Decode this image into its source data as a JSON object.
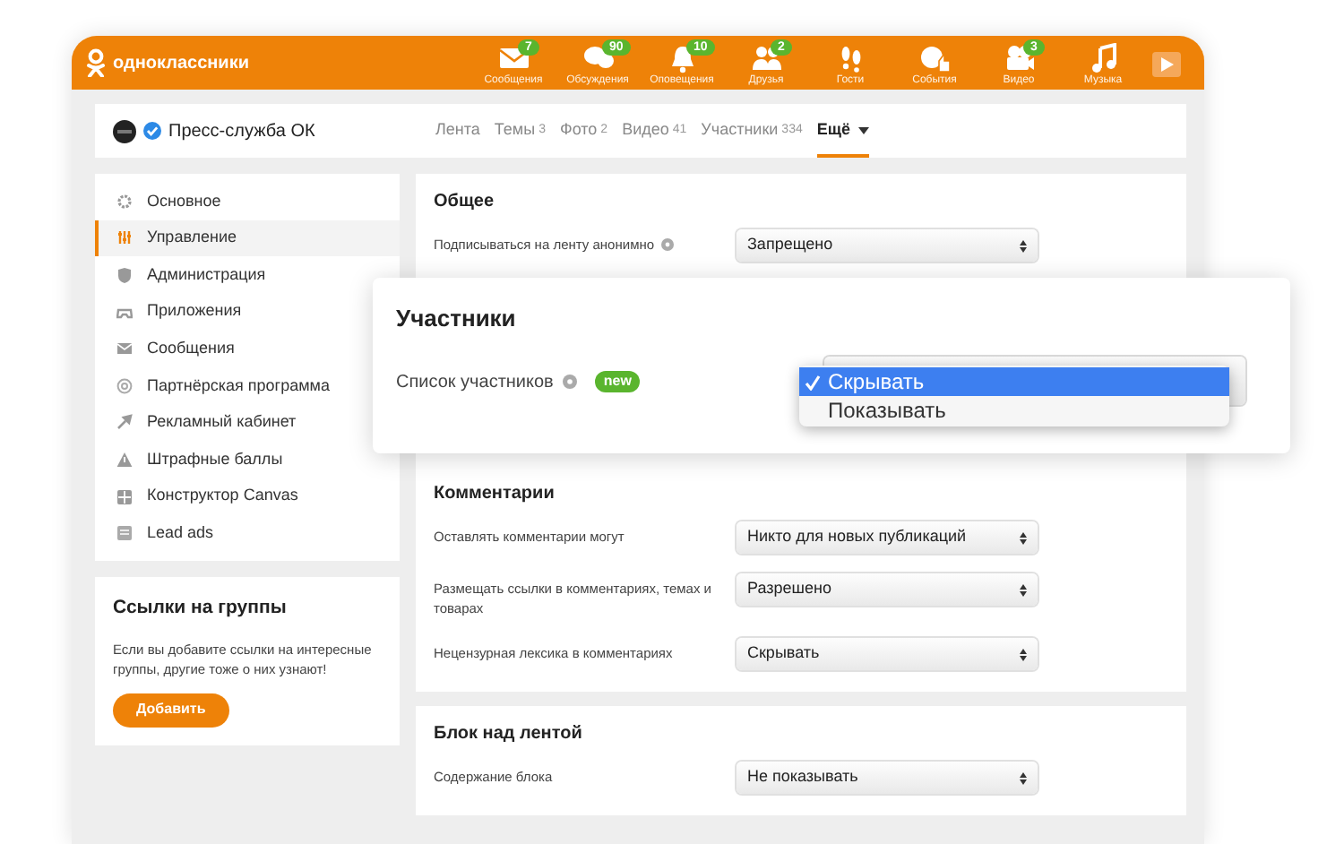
{
  "header": {
    "logo_text": "одноклассники",
    "nav": [
      {
        "label": "Сообщения",
        "badge": "7"
      },
      {
        "label": "Обсуждения",
        "badge": "90"
      },
      {
        "label": "Оповещения",
        "badge": "10"
      },
      {
        "label": "Друзья",
        "badge": "2"
      },
      {
        "label": "Гости"
      },
      {
        "label": "События"
      },
      {
        "label": "Видео",
        "badge": "3"
      },
      {
        "label": "Музыка"
      }
    ]
  },
  "profile": {
    "name": "Пресс-служба ОК",
    "verified": true,
    "tabs": [
      {
        "label": "Лента",
        "selected": false
      },
      {
        "label": "Темы",
        "count": "3",
        "selected": false
      },
      {
        "label": "Фото",
        "count": "2",
        "selected": false
      },
      {
        "label": "Видео",
        "count": "41",
        "selected": false
      },
      {
        "label": "Участники",
        "count": "334",
        "selected": false
      },
      {
        "label": "Ещё",
        "selected": true
      }
    ]
  },
  "sidebar": {
    "items": [
      {
        "label": "Основное",
        "selected": false
      },
      {
        "label": "Управление",
        "selected": true
      },
      {
        "label": "Администрация",
        "selected": false
      },
      {
        "label": "Приложения",
        "selected": false
      },
      {
        "label": "Сообщения",
        "selected": false
      },
      {
        "label": "Партнёрская программа",
        "selected": false
      },
      {
        "label": "Рекламный кабинет",
        "selected": false
      },
      {
        "label": "Штрафные баллы",
        "selected": false
      },
      {
        "label": "Конструктор Canvas",
        "selected": false
      },
      {
        "label": "Lead ads",
        "selected": false
      }
    ]
  },
  "group_links": {
    "title": "Ссылки на группы",
    "text": "Если вы добавите ссылки на интересные группы, другие тоже о них узнают!",
    "button": "Добавить"
  },
  "sections": [
    {
      "title": "Общее",
      "settings": [
        {
          "label": "Подписываться на ленту анонимно",
          "help": true,
          "value": "Запрещено"
        }
      ]
    },
    {
      "title": "Комментарии",
      "settings": [
        {
          "label": "Оставлять комментарии могут",
          "help": false,
          "value": "Никто для новых публикаций"
        },
        {
          "label": "Размещать ссылки в комментариях, темах и товарах",
          "help": false,
          "value": "Разрешено"
        },
        {
          "label": "Нецензурная лексика в комментариях",
          "help": false,
          "value": "Скрывать"
        }
      ]
    },
    {
      "title": "Блок над лентой",
      "settings": [
        {
          "label": "Содержание блока",
          "help": false,
          "value": "Не показывать"
        }
      ]
    }
  ],
  "popup": {
    "title": "Участники",
    "setting": {
      "label": "Список участников",
      "help": true,
      "badge": "new"
    },
    "options": [
      {
        "label": "Скрывать",
        "selected": true
      },
      {
        "label": "Показывать",
        "selected": false
      }
    ]
  }
}
